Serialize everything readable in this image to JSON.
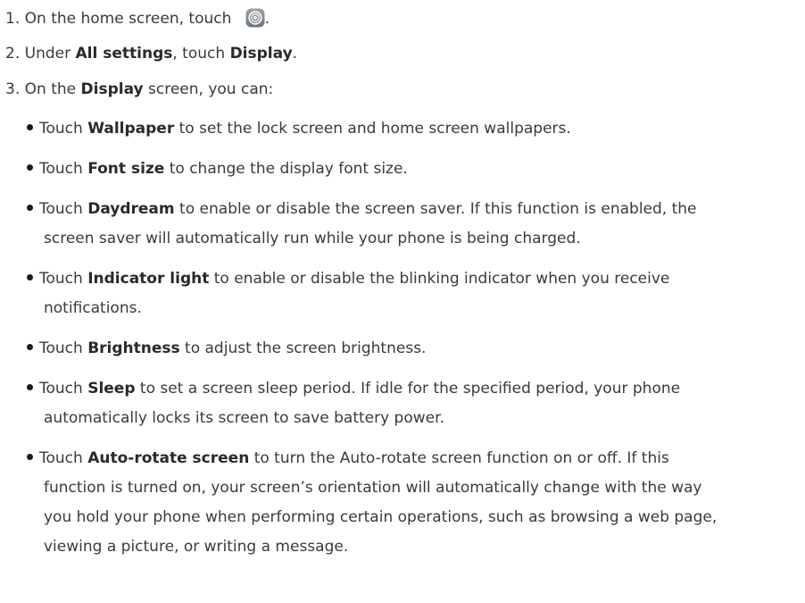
{
  "steps": [
    {
      "num": "1.",
      "pre": "On the home screen, touch",
      "post": "."
    },
    {
      "num": "2.",
      "pre": "Under ",
      "b1": "All settings",
      "mid": ", touch ",
      "b2": "Display",
      "post": "."
    },
    {
      "num": "3.",
      "pre": "On the ",
      "b1": "Display",
      "post": " screen, you can:"
    }
  ],
  "bullets": [
    {
      "b": "Wallpaper",
      "text": " to set the lock screen and home screen wallpapers."
    },
    {
      "b": "Font size",
      "text": " to change the display font size."
    },
    {
      "b": "Daydream",
      "text": " to enable or disable the screen saver. If this function is enabled, the",
      "cont": [
        "screen saver will automatically run while your phone is being charged."
      ]
    },
    {
      "b": "Indicator light",
      "text": " to enable or disable the blinking indicator when you receive",
      "cont": [
        "notifications."
      ]
    },
    {
      "b": "Brightness",
      "text": " to adjust the screen brightness."
    },
    {
      "b": "Sleep",
      "text": " to set a screen sleep period. If idle for the specified period, your phone",
      "cont": [
        "automatically locks its screen to save battery power."
      ]
    },
    {
      "b": "Auto-rotate screen",
      "text": " to turn the Auto-rotate screen function on or off. If this",
      "cont": [
        "function is turned on, your screen’s orientation will automatically change with the way",
        "you hold your phone when performing certain operations, such as browsing a web page,",
        "viewing a picture, or writing a message."
      ]
    }
  ],
  "touch_word": "Touch",
  "icon": "settings-gear-icon"
}
